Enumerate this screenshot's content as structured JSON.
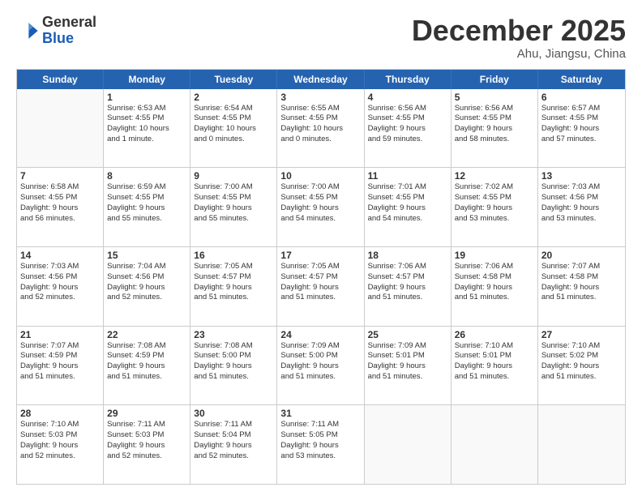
{
  "header": {
    "logo_general": "General",
    "logo_blue": "Blue",
    "main_title": "December 2025",
    "sub_title": "Ahu, Jiangsu, China"
  },
  "calendar": {
    "days_of_week": [
      "Sunday",
      "Monday",
      "Tuesday",
      "Wednesday",
      "Thursday",
      "Friday",
      "Saturday"
    ],
    "rows": [
      [
        {
          "day": "",
          "info": ""
        },
        {
          "day": "1",
          "info": "Sunrise: 6:53 AM\nSunset: 4:55 PM\nDaylight: 10 hours\nand 1 minute."
        },
        {
          "day": "2",
          "info": "Sunrise: 6:54 AM\nSunset: 4:55 PM\nDaylight: 10 hours\nand 0 minutes."
        },
        {
          "day": "3",
          "info": "Sunrise: 6:55 AM\nSunset: 4:55 PM\nDaylight: 10 hours\nand 0 minutes."
        },
        {
          "day": "4",
          "info": "Sunrise: 6:56 AM\nSunset: 4:55 PM\nDaylight: 9 hours\nand 59 minutes."
        },
        {
          "day": "5",
          "info": "Sunrise: 6:56 AM\nSunset: 4:55 PM\nDaylight: 9 hours\nand 58 minutes."
        },
        {
          "day": "6",
          "info": "Sunrise: 6:57 AM\nSunset: 4:55 PM\nDaylight: 9 hours\nand 57 minutes."
        }
      ],
      [
        {
          "day": "7",
          "info": "Sunrise: 6:58 AM\nSunset: 4:55 PM\nDaylight: 9 hours\nand 56 minutes."
        },
        {
          "day": "8",
          "info": "Sunrise: 6:59 AM\nSunset: 4:55 PM\nDaylight: 9 hours\nand 55 minutes."
        },
        {
          "day": "9",
          "info": "Sunrise: 7:00 AM\nSunset: 4:55 PM\nDaylight: 9 hours\nand 55 minutes."
        },
        {
          "day": "10",
          "info": "Sunrise: 7:00 AM\nSunset: 4:55 PM\nDaylight: 9 hours\nand 54 minutes."
        },
        {
          "day": "11",
          "info": "Sunrise: 7:01 AM\nSunset: 4:55 PM\nDaylight: 9 hours\nand 54 minutes."
        },
        {
          "day": "12",
          "info": "Sunrise: 7:02 AM\nSunset: 4:55 PM\nDaylight: 9 hours\nand 53 minutes."
        },
        {
          "day": "13",
          "info": "Sunrise: 7:03 AM\nSunset: 4:56 PM\nDaylight: 9 hours\nand 53 minutes."
        }
      ],
      [
        {
          "day": "14",
          "info": "Sunrise: 7:03 AM\nSunset: 4:56 PM\nDaylight: 9 hours\nand 52 minutes."
        },
        {
          "day": "15",
          "info": "Sunrise: 7:04 AM\nSunset: 4:56 PM\nDaylight: 9 hours\nand 52 minutes."
        },
        {
          "day": "16",
          "info": "Sunrise: 7:05 AM\nSunset: 4:57 PM\nDaylight: 9 hours\nand 51 minutes."
        },
        {
          "day": "17",
          "info": "Sunrise: 7:05 AM\nSunset: 4:57 PM\nDaylight: 9 hours\nand 51 minutes."
        },
        {
          "day": "18",
          "info": "Sunrise: 7:06 AM\nSunset: 4:57 PM\nDaylight: 9 hours\nand 51 minutes."
        },
        {
          "day": "19",
          "info": "Sunrise: 7:06 AM\nSunset: 4:58 PM\nDaylight: 9 hours\nand 51 minutes."
        },
        {
          "day": "20",
          "info": "Sunrise: 7:07 AM\nSunset: 4:58 PM\nDaylight: 9 hours\nand 51 minutes."
        }
      ],
      [
        {
          "day": "21",
          "info": "Sunrise: 7:07 AM\nSunset: 4:59 PM\nDaylight: 9 hours\nand 51 minutes."
        },
        {
          "day": "22",
          "info": "Sunrise: 7:08 AM\nSunset: 4:59 PM\nDaylight: 9 hours\nand 51 minutes."
        },
        {
          "day": "23",
          "info": "Sunrise: 7:08 AM\nSunset: 5:00 PM\nDaylight: 9 hours\nand 51 minutes."
        },
        {
          "day": "24",
          "info": "Sunrise: 7:09 AM\nSunset: 5:00 PM\nDaylight: 9 hours\nand 51 minutes."
        },
        {
          "day": "25",
          "info": "Sunrise: 7:09 AM\nSunset: 5:01 PM\nDaylight: 9 hours\nand 51 minutes."
        },
        {
          "day": "26",
          "info": "Sunrise: 7:10 AM\nSunset: 5:01 PM\nDaylight: 9 hours\nand 51 minutes."
        },
        {
          "day": "27",
          "info": "Sunrise: 7:10 AM\nSunset: 5:02 PM\nDaylight: 9 hours\nand 51 minutes."
        }
      ],
      [
        {
          "day": "28",
          "info": "Sunrise: 7:10 AM\nSunset: 5:03 PM\nDaylight: 9 hours\nand 52 minutes."
        },
        {
          "day": "29",
          "info": "Sunrise: 7:11 AM\nSunset: 5:03 PM\nDaylight: 9 hours\nand 52 minutes."
        },
        {
          "day": "30",
          "info": "Sunrise: 7:11 AM\nSunset: 5:04 PM\nDaylight: 9 hours\nand 52 minutes."
        },
        {
          "day": "31",
          "info": "Sunrise: 7:11 AM\nSunset: 5:05 PM\nDaylight: 9 hours\nand 53 minutes."
        },
        {
          "day": "",
          "info": ""
        },
        {
          "day": "",
          "info": ""
        },
        {
          "day": "",
          "info": ""
        }
      ]
    ]
  }
}
